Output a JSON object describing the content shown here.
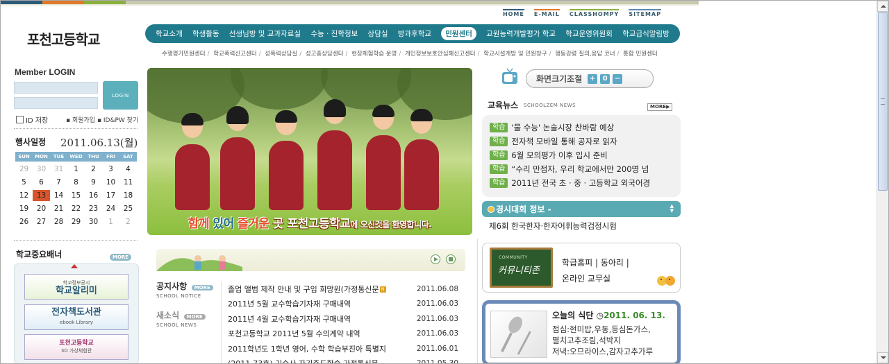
{
  "utility_links": [
    "HOME",
    "E-MAIL",
    "CLASSHOMPY",
    "SITEMAP"
  ],
  "school_name": "포천고등학교",
  "gnb": [
    "학교소개",
    "학생활동",
    "선생님방 및 교과자료실",
    "수능 · 진학정보",
    "상담실",
    "방과후학교",
    "민원센터",
    "교원능력개발평가 학교",
    "학교운영위원회",
    "학교급식알림방"
  ],
  "gnb_active": "민원센터",
  "snb": [
    "수행평가민원센터",
    "학교폭력신고센터",
    "성폭력상담실",
    "성고충상담센터",
    "현장체험학습 운영",
    "개인정보보호안심해신고센터",
    "학교시설개방 및 민원창구",
    "행동강령 질의,응답 코너",
    "통합 민원센터"
  ],
  "login": {
    "title": "Member LOGIN",
    "button": "LOGIN",
    "save_id": "ID 저장",
    "join": "▪ 회원가입  ▪ ID&PW 찾기"
  },
  "calendar": {
    "title": "행사일정",
    "date": "2011.06.13(월)",
    "weekdays": [
      "SUN",
      "MON",
      "TUE",
      "WED",
      "THU",
      "FRI",
      "SAT"
    ],
    "weeks": [
      [
        "29",
        "30",
        "31",
        "1",
        "2",
        "3",
        "4"
      ],
      [
        "5",
        "6",
        "7",
        "8",
        "9",
        "10",
        "11"
      ],
      [
        "12",
        "13",
        "14",
        "15",
        "16",
        "17",
        "18"
      ],
      [
        "19",
        "20",
        "21",
        "22",
        "23",
        "24",
        "25"
      ],
      [
        "26",
        "27",
        "28",
        "29",
        "30",
        "1",
        "2"
      ]
    ],
    "today": "13"
  },
  "banner": {
    "title": "학교중요배너",
    "more": "MORE",
    "items": [
      {
        "top": "학교정보공시",
        "main": "학교알리미"
      },
      {
        "main": "전자책도서관",
        "sub": "ebook Library"
      },
      {
        "main": "포천고등학교",
        "sub": "3D 가상체험관"
      }
    ]
  },
  "hero": {
    "part1": "함께",
    "part2": " 있어 ",
    "part3": "즐거운",
    "part4": " 곳 포천고등학교",
    "part5": "에 오신것을 환영합니다."
  },
  "board": {
    "tabs": [
      {
        "title": "공지사항",
        "sub": "SCHOOL NOTICE",
        "more": "MORE"
      },
      {
        "title": "새소식",
        "sub": "SCHOOL NEWS",
        "more": "MORE"
      }
    ],
    "rows": [
      {
        "title": "졸업 앨범 제작 안내 및 구입 희망원(가정통신문",
        "date": "2011.06.08",
        "badge": "N"
      },
      {
        "title": "2011년 5월 교수학습기자재 구매내역",
        "date": "2011.06.03"
      },
      {
        "title": "2011년 4월 교수학습기자재 구매내역",
        "date": "2011.06.03"
      },
      {
        "title": "포천고등학교 2011년 5월 수의계약 내역",
        "date": "2011.06.03"
      },
      {
        "title": "2011학년도 1학년 영어, 수학 학습부진아 특별지",
        "date": "2011.06.01"
      },
      {
        "title": "(2011-73호) 기숙사 자기주도학습 가정통신문",
        "date": "2011.05.30"
      }
    ]
  },
  "zoom": {
    "label": "화면크기조절",
    "plus": "+",
    "reset": "0",
    "minus": "−"
  },
  "news": {
    "title": "교육뉴스",
    "sub": "SCHOOLZEM NEWS",
    "more": "MORE▶",
    "items": [
      {
        "cat": "학습",
        "title": "'물 수능' 논술시장 찬바람 예상"
      },
      {
        "cat": "학습",
        "title": "전자책 모바일 통해 공자로 읽자"
      },
      {
        "cat": "학습",
        "title": "6월 모의평가 이후 입시 준비"
      },
      {
        "cat": "학습",
        "title": "“수리 만점자, 우리 학교에서만 200명 넘"
      },
      {
        "cat": "학습",
        "title": "2011년 전국 초 · 중 · 고등학교 외국어경"
      }
    ]
  },
  "contest": {
    "title": "경시대회 정보 -",
    "item": "제6회 한국한자·한자어휘능력검정시험"
  },
  "community": {
    "small": "COMMUNITY",
    "big": "커뮤니티존",
    "links": "학급홈피  |  동아리  |",
    "links2": "온라인 교무실"
  },
  "meal": {
    "title": "오늘의 식단",
    "date": "2011. 06. 13.",
    "lunch": "점심:현미밥,우동,등심돈가스,",
    "lunch2": "멸치고추조림,석박지",
    "dinner": "저녁:오므라이스,감자고추가루"
  }
}
